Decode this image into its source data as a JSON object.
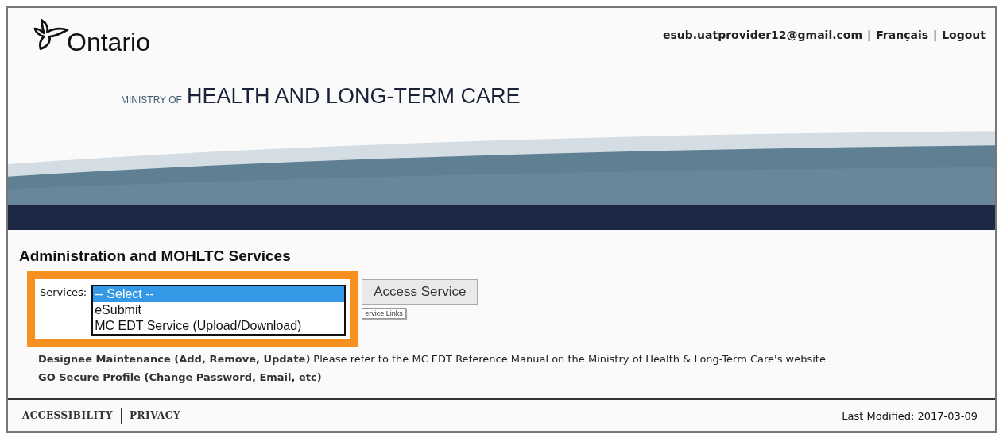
{
  "header": {
    "logo_text": "Ontario",
    "ministry_prefix": "MINISTRY OF",
    "ministry_name": "HEALTH AND LONG-TERM CARE",
    "separator": "|",
    "user_links": [
      {
        "text": "esub.uatprovider12@gmail.com"
      },
      {
        "text": "Français"
      },
      {
        "text": "Logout"
      }
    ]
  },
  "section_title": "Administration and MOHLTC Services",
  "services": {
    "label": "Services:",
    "options": [
      {
        "label": "-- Select --",
        "selected": true
      },
      {
        "label": "eSubmit",
        "selected": false
      },
      {
        "label": "MC EDT Service (Upload/Download)",
        "selected": false
      }
    ],
    "button": "Access Service",
    "tooltip": "ervice Links"
  },
  "links": [
    {
      "text": "Designee Maintenance (Add, Remove, Update)",
      "note": "Please refer to the MC EDT Reference Manual on the Ministry of Health & Long-Term Care's website"
    },
    {
      "text": "GO Secure Profile (Change Password, Email, etc)"
    }
  ],
  "footer": {
    "links": [
      "ACCESSIBILITY",
      "PRIVACY"
    ],
    "last_modified": "Last Modified: 2017-03-09"
  }
}
